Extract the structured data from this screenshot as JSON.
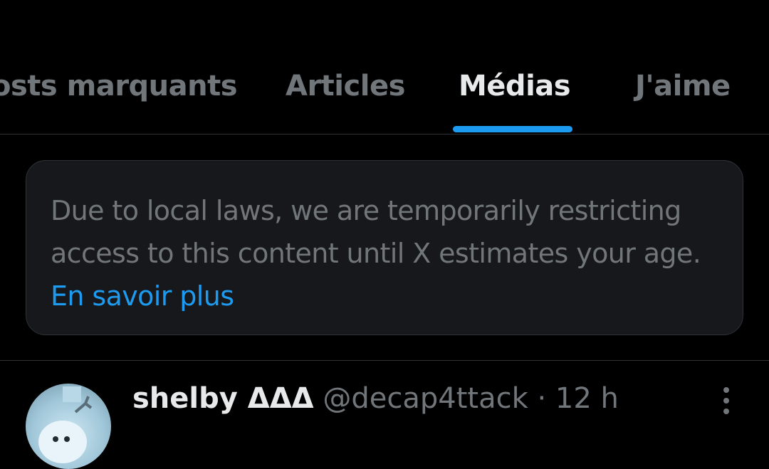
{
  "tabs": [
    {
      "label": "osts marquants",
      "active": false
    },
    {
      "label": "Articles",
      "active": false
    },
    {
      "label": "Médias",
      "active": true
    },
    {
      "label": "J'aime",
      "active": false
    }
  ],
  "notice": {
    "text": "Due to local laws, we are temporarily restricting access to this content until X estimates your age.",
    "link_label": "En savoir plus"
  },
  "post": {
    "display_name": "shelby ΔΔΔ",
    "handle": "@decap4ttack",
    "separator": "·",
    "time": "12 h"
  },
  "icons": {
    "more": "more-vertical-icon",
    "avatar": "avatar"
  },
  "colors": {
    "background": "#000000",
    "accent": "#1d9bf0",
    "muted_text": "#71767b",
    "primary_text": "#e7e9ea",
    "border": "#2f3336",
    "card": "#16181c"
  }
}
